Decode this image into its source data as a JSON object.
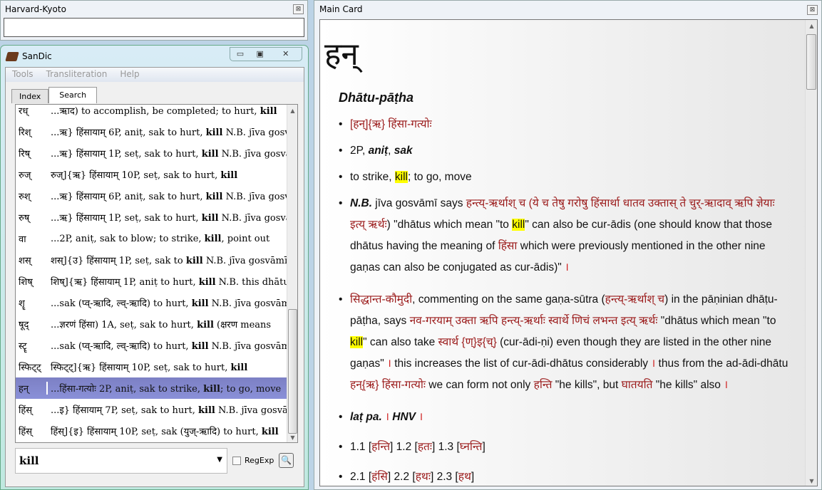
{
  "harvard_kyoto": {
    "title": "Harvard-Kyoto",
    "input_value": "",
    "close": "⊠"
  },
  "sandic": {
    "title": "SanDic",
    "controls": {
      "minimize": "▭",
      "maximize": "▣",
      "close": "✕"
    },
    "menu": [
      "Tools",
      "Transliteration",
      "Help"
    ],
    "tabs": [
      {
        "label": "Index",
        "active": false
      },
      {
        "label": "Search",
        "active": true
      }
    ],
    "results": [
      {
        "root": "रध्",
        "pre": "...ऋाद) to accomplish, be completed; to hurt, ",
        "kw": "kill",
        "post": ""
      },
      {
        "root": "रिश्",
        "pre": "...ऋ} हिंसायाम् 6P, aniṭ, sak to hurt, ",
        "kw": "kill",
        "post": " N.B. jīva gosvāmī"
      },
      {
        "root": "रिष्",
        "pre": "...ऋ} हिंसायाम् 1P, seṭ, sak to hurt, ",
        "kw": "kill",
        "post": " N.B. jīva gosvāmī"
      },
      {
        "root": "रुज्",
        "pre": "रुज्]{ऋ} हिंसायाम् 10P, seṭ, sak to hurt, ",
        "kw": "kill",
        "post": ""
      },
      {
        "root": "रुश्",
        "pre": "...ऋ} हिंसायाम् 6P, aniṭ, sak to hurt, ",
        "kw": "kill",
        "post": " N.B. jīva gosvāmī"
      },
      {
        "root": "रुष्",
        "pre": "...ऋ} हिंसायाम् 1P, seṭ, sak to hurt, ",
        "kw": "kill",
        "post": " N.B. jīva gosvāmī"
      },
      {
        "root": "वा",
        "pre": "...2P, aniṭ, sak to blow; to strike, ",
        "kw": "kill",
        "post": ", point out"
      },
      {
        "root": "शस्",
        "pre": "शस्]{उ} हिंसायाम् 1P, seṭ, sak to ",
        "kw": "kill",
        "post": " N.B. jīva gosvāmī"
      },
      {
        "root": "शिष्",
        "pre": "शिष्]{ऋ} हिंसायाम् 1P, aniṭ to hurt, ",
        "kw": "kill",
        "post": " N.B. this dhātu"
      },
      {
        "root": "शॄ",
        "pre": "...sak (प्व्-ऋादि, ल्व्-ऋादि) to hurt, ",
        "kw": "kill",
        "post": " N.B. jīva gosvāmī"
      },
      {
        "root": "षूद्",
        "pre": "...ज्ञरणं हिंसा) 1A, seṭ, sak to hurt, ",
        "kw": "kill",
        "post": " (क्षरण means"
      },
      {
        "root": "स्टॄ",
        "pre": "...sak (प्व्-ऋादि, ल्व्-ऋादि) to hurt, ",
        "kw": "kill",
        "post": " N.B. jīva gosvāmī"
      },
      {
        "root": "स्फिट्ट्",
        "pre": "स्फिट्ट्]{ऋ} हिंसायाम् 10P, seṭ, sak to hurt, ",
        "kw": "kill",
        "post": ""
      },
      {
        "root": "हन्",
        "pre": "...हिंसा-गत्योः 2P, aniṭ, sak to strike, ",
        "kw": "kill",
        "post": "; to go, move",
        "selected": true
      },
      {
        "root": "हिंस्",
        "pre": "...इ} हिंसायाम् 7P, seṭ, sak to hurt, ",
        "kw": "kill",
        "post": " N.B. jīva gosvāmī"
      },
      {
        "root": "हिंस्",
        "pre": "हिंस्]{इ} हिंसायाम् 10P, seṭ, sak (युज्-ऋादि) to hurt, ",
        "kw": "kill",
        "post": ""
      }
    ],
    "search_value": "kill",
    "regexp_label": "RegExp",
    "regexp_checked": false
  },
  "main_card": {
    "title": "Main Card",
    "close": "⊠",
    "headword": "हन्",
    "section": "Dhātu-pāṭha",
    "bullets": [
      [
        {
          "t": "[हन्]{ऋ} हिंसा-गत्योः",
          "c": "d"
        }
      ],
      [
        {
          "t": "2P, "
        },
        {
          "t": "aniṭ",
          "c": "bi"
        },
        {
          "t": ", "
        },
        {
          "t": "sak",
          "c": "bi"
        }
      ],
      [
        {
          "t": "to strike, "
        },
        {
          "t": "kill",
          "c": "hl"
        },
        {
          "t": "; to go, move"
        }
      ],
      [
        {
          "t": "N.B.",
          "c": "bi"
        },
        {
          "t": " jīva gosvāmī says "
        },
        {
          "t": "हन्त्य्-ऋर्थाश् च (ये च तेषु गरोषु हिंसार्था धातव उक्तास् ते चुर्-ऋादाव् ऋपि ज्ञेयाः इत्य् ऋर्थः",
          "c": "d"
        },
        {
          "t": ") \"dhātus which mean \"to "
        },
        {
          "t": "kill",
          "c": "hl"
        },
        {
          "t": "\" can also be cur-ādis (one should know that those dhātus having the meaning of "
        },
        {
          "t": "हिंसा",
          "c": "d"
        },
        {
          "t": " which were previously mentioned in the other nine gaṇas can also be conjugated as cur-ādis)\" "
        },
        {
          "t": "।",
          "c": "dan"
        }
      ],
      [
        {
          "t": "सिद्धान्त-कौमुदी",
          "c": "d"
        },
        {
          "t": ", commenting on the same gaṇa-sūtra ("
        },
        {
          "t": "हन्त्य्-ऋर्थाश् च",
          "c": "d"
        },
        {
          "t": ") in the pāṇinian dhāṭu-pāṭha, says "
        },
        {
          "t": "नव-गरयाम् उक्ता ऋपि हन्त्य्-ऋर्थाः स्वार्थे णिचं लभन्त इत्य् ऋर्थः",
          "c": "d"
        },
        {
          "t": " \"dhātus which mean \"to "
        },
        {
          "t": "kill",
          "c": "hl"
        },
        {
          "t": "\" can also take "
        },
        {
          "t": "स्वार्थ {ण्}इ{च्}",
          "c": "d"
        },
        {
          "t": " (cur-ādi-ṇi) even though they are listed in the other nine gaṇas\" "
        },
        {
          "t": "।",
          "c": "dan"
        },
        {
          "t": " this increases the list of cur-ādi-dhātus considerably "
        },
        {
          "t": "।",
          "c": "dan"
        },
        {
          "t": " thus from the ad-ādi-dhātu "
        },
        {
          "t": "हन्{ऋ} हिंसा-गत्योः",
          "c": "d"
        },
        {
          "t": " we can form not only "
        },
        {
          "t": "हन्ति",
          "c": "d"
        },
        {
          "t": " \"he kills\", but "
        },
        {
          "t": "घातयति",
          "c": "d"
        },
        {
          "t": " \"he kills\" also "
        },
        {
          "t": "।",
          "c": "dan"
        }
      ],
      [
        {
          "t": "laṭ pa.",
          "c": "bi"
        },
        {
          "t": " । ",
          "c": "dan"
        },
        {
          "t": "HNV",
          "c": "bi"
        },
        {
          "t": " ।",
          "c": "dan"
        }
      ],
      [
        {
          "t": "1.1 ["
        },
        {
          "t": "हन्ति",
          "c": "d"
        },
        {
          "t": "] 1.2 ["
        },
        {
          "t": "हतः",
          "c": "d"
        },
        {
          "t": "] 1.3 ["
        },
        {
          "t": "घ्नन्ति",
          "c": "d"
        },
        {
          "t": "]"
        }
      ],
      [
        {
          "t": "2.1 ["
        },
        {
          "t": "हंसि",
          "c": "d"
        },
        {
          "t": "] 2.2 ["
        },
        {
          "t": "हथः",
          "c": "d"
        },
        {
          "t": "] 2.3 ["
        },
        {
          "t": "हथ",
          "c": "d"
        },
        {
          "t": "]"
        }
      ]
    ]
  },
  "colors": {
    "devanagari": "#9b1b1b",
    "highlight": "#ffff00",
    "selection": "#8085cc"
  }
}
